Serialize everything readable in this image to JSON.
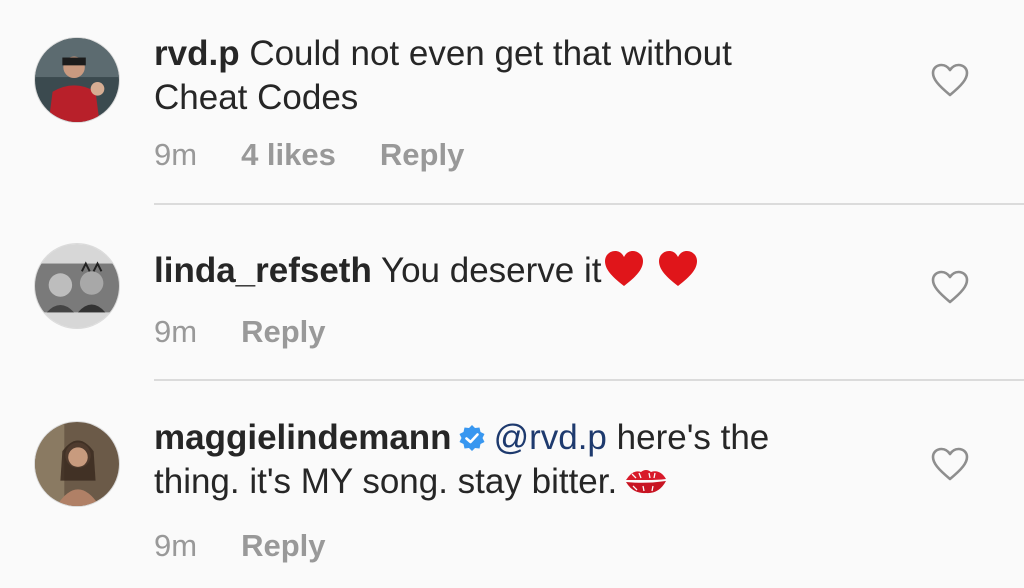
{
  "comments": [
    {
      "username": "rvd.p",
      "text_line1": "Could not even get that without",
      "text_line2": "Cheat Codes",
      "time": "9m",
      "likes": "4 likes",
      "reply": "Reply"
    },
    {
      "username": "linda_refseth",
      "text": "You deserve it",
      "emoji": "red-heart-icon",
      "time": "9m",
      "reply": "Reply"
    },
    {
      "username": "maggielindemann",
      "verified": true,
      "mention": "@rvd.p",
      "text_line1": "here's the",
      "text_line2": "thing. it's MY song. stay bitter.",
      "emoji": "kiss-mark-icon",
      "time": "9m",
      "reply": "Reply"
    }
  ],
  "colors": {
    "background": "#fafafa",
    "text": "#262626",
    "meta": "#999999",
    "mention": "#1e3a6e",
    "verified": "#3897f0",
    "emoji_red": "#e0151a"
  }
}
